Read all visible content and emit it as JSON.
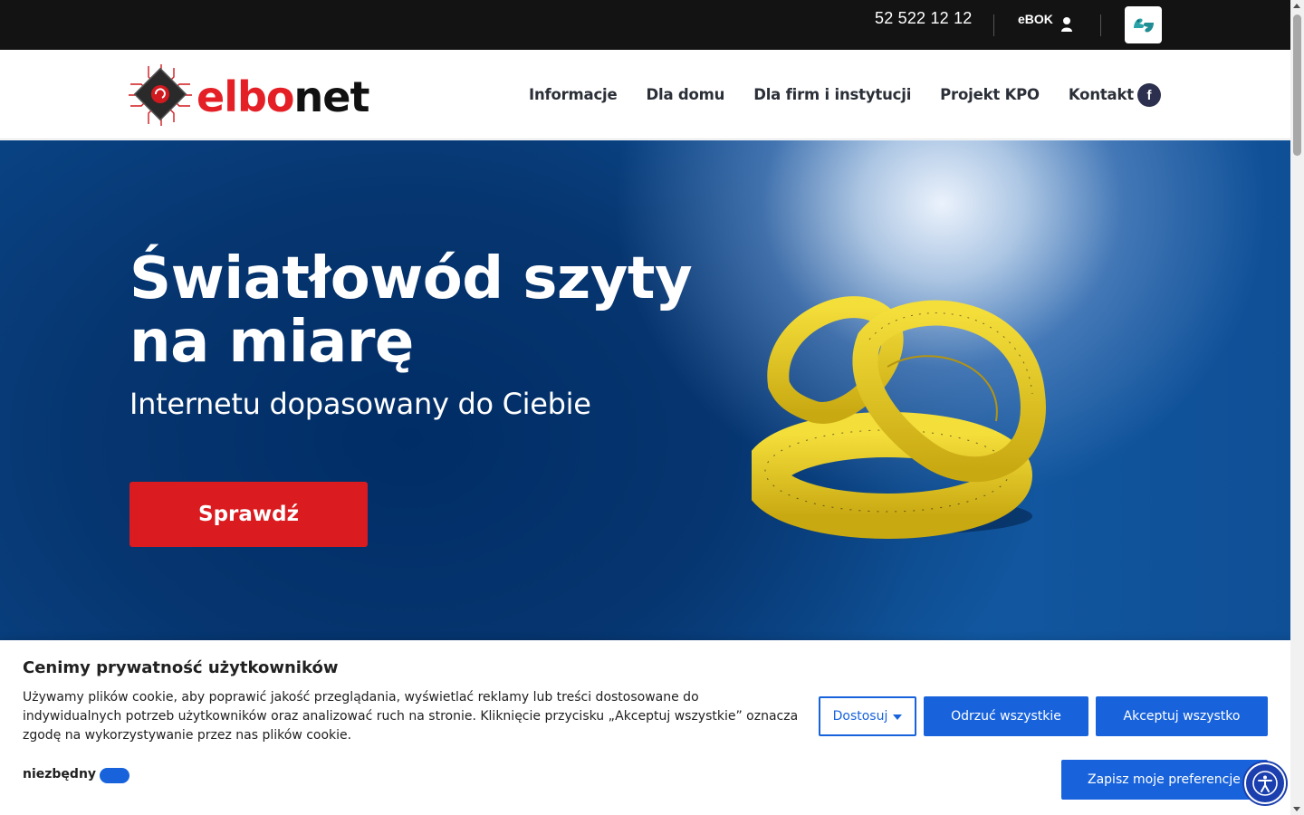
{
  "topbar": {
    "phone": "52 522 12 12",
    "ebok_label": "eBOK",
    "ebok_icon": "user-icon",
    "sign_language_icon": "sign-language-icon"
  },
  "header": {
    "logo": {
      "part1": "elbo",
      "part2": "net"
    },
    "nav": [
      {
        "label": "Informacje"
      },
      {
        "label": "Dla domu"
      },
      {
        "label": "Dla firm i instytucji"
      },
      {
        "label": "Projekt KPO"
      },
      {
        "label": "Kontakt"
      }
    ],
    "facebook_label": "f"
  },
  "hero": {
    "title_line1": "Światłowód szyty",
    "title_line2": "na miarę",
    "subtitle": "Internetu dopasowany do Ciebie",
    "cta_label": "Sprawdź",
    "image_icon": "measuring-tape-image"
  },
  "cookie_banner": {
    "title": "Cenimy prywatność użytkowników",
    "text": "Używamy plików cookie, aby poprawić jakość przeglądania, wyświetlać reklamy lub treści dostosowane do indywidualnych potrzeb użytkowników oraz analizować ruch na stronie. Kliknięcie przycisku „Akceptuj wszystkie” oznacza zgodę na wykorzystywanie przez nas plików cookie.",
    "toggle_label": "niezbędny",
    "customize_label": "Dostosuj",
    "reject_label": "Odrzuć wszystkie",
    "accept_label": "Akceptuj wszystko",
    "save_label": "Zapisz moje preferencje"
  },
  "colors": {
    "brand_red": "#da1b1f",
    "primary_blue": "#1863dc",
    "topbar_bg": "#131313",
    "nav_text": "#2b2f38"
  }
}
